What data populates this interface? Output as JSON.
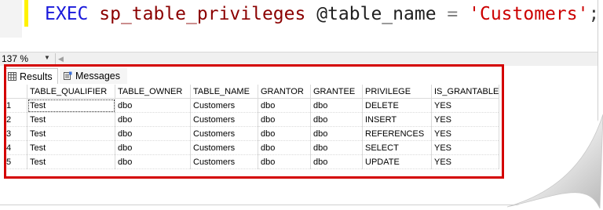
{
  "editor": {
    "kw_exec": "EXEC",
    "proc_name": "sp_table_privileges",
    "param": "@table_name",
    "equals": "=",
    "string_value": "'Customers'",
    "terminator": ";"
  },
  "zoom": {
    "value": "137 %"
  },
  "tabs": {
    "results": "Results",
    "messages": "Messages"
  },
  "grid": {
    "headers": [
      "TABLE_QUALIFIER",
      "TABLE_OWNER",
      "TABLE_NAME",
      "GRANTOR",
      "GRANTEE",
      "PRIVILEGE",
      "IS_GRANTABLE"
    ],
    "rows": [
      {
        "n": "1",
        "cells": [
          "Test",
          "dbo",
          "Customers",
          "dbo",
          "dbo",
          "DELETE",
          "YES"
        ]
      },
      {
        "n": "2",
        "cells": [
          "Test",
          "dbo",
          "Customers",
          "dbo",
          "dbo",
          "INSERT",
          "YES"
        ]
      },
      {
        "n": "3",
        "cells": [
          "Test",
          "dbo",
          "Customers",
          "dbo",
          "dbo",
          "REFERENCES",
          "YES"
        ]
      },
      {
        "n": "4",
        "cells": [
          "Test",
          "dbo",
          "Customers",
          "dbo",
          "dbo",
          "SELECT",
          "YES"
        ]
      },
      {
        "n": "5",
        "cells": [
          "Test",
          "dbo",
          "Customers",
          "dbo",
          "dbo",
          "UPDATE",
          "YES"
        ]
      }
    ]
  },
  "colors": {
    "highlight": "#d40000",
    "keyword": "#1a1adb",
    "string": "#cc0000",
    "change_bar": "#fff200"
  }
}
